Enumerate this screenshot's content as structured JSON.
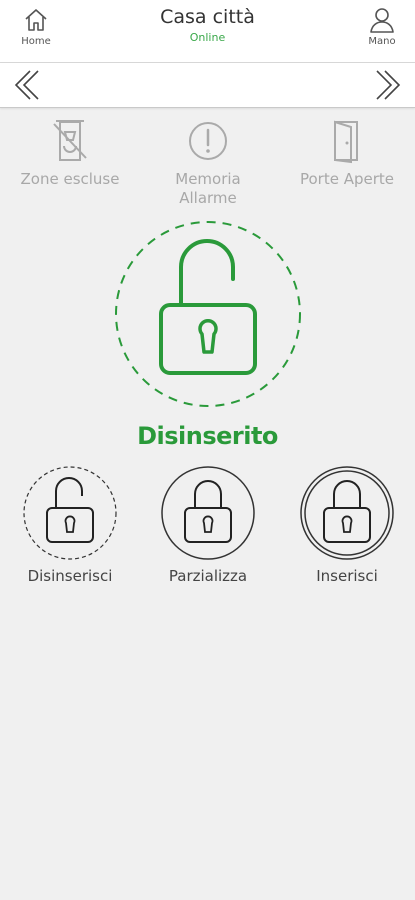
{
  "header": {
    "home_label": "Home",
    "title": "Casa città",
    "status": "Online",
    "user_label": "Mano"
  },
  "quick_status": {
    "items": [
      {
        "label": "Zone escluse",
        "icon": "excluded-zones-icon"
      },
      {
        "label": "Memoria\nAllarme",
        "icon": "alarm-memory-icon"
      },
      {
        "label": "Porte Aperte",
        "icon": "open-doors-icon"
      }
    ]
  },
  "main": {
    "state_label": "Disinserito",
    "state_color": "#2a9a3a",
    "lock_icon": "unlocked-padlock-icon"
  },
  "modes": {
    "items": [
      {
        "label": "Disinserisci",
        "icon": "unlocked-padlock-icon"
      },
      {
        "label": "Parzializza",
        "icon": "padlock-icon"
      },
      {
        "label": "Inserisci",
        "icon": "padlock-icon"
      }
    ]
  },
  "colors": {
    "accent_green": "#2a9a3a",
    "online_green": "#3aa84a",
    "inactive_gray": "#a8a8a8"
  }
}
